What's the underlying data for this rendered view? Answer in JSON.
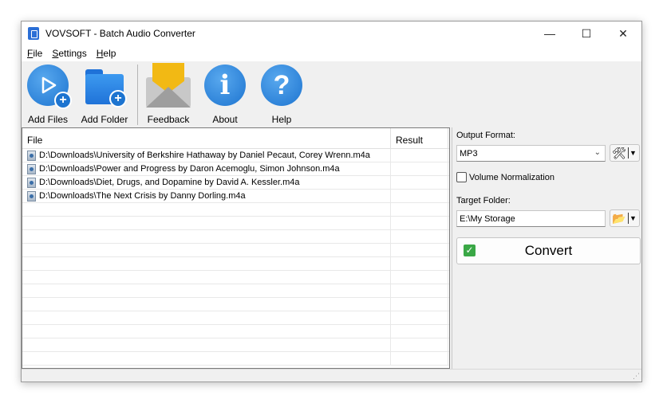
{
  "titlebar": {
    "title": "VOVSOFT - Batch Audio Converter",
    "minimize": "—",
    "maximize": "☐",
    "close": "✕"
  },
  "menu": {
    "file_u": "F",
    "file_rest": "ile",
    "settings_u": "S",
    "settings_rest": "ettings",
    "help_u": "H",
    "help_rest": "elp"
  },
  "toolbar": {
    "add_files": "Add Files",
    "add_folder": "Add Folder",
    "feedback": "Feedback",
    "about": "About",
    "help": "Help",
    "about_glyph": "i",
    "help_glyph": "?",
    "plus_glyph": "+"
  },
  "list": {
    "col_file": "File",
    "col_result": "Result",
    "rows": [
      "D:\\Downloads\\University of Berkshire Hathaway by Daniel Pecaut, Corey Wrenn.m4a",
      "D:\\Downloads\\Power and Progress by Daron Acemoglu, Simon Johnson.m4a",
      "D:\\Downloads\\Diet, Drugs, and Dopamine by David A. Kessler.m4a",
      "D:\\Downloads\\The Next Crisis by Danny Dorling.m4a"
    ]
  },
  "options": {
    "output_format_label": "Output Format:",
    "output_format_value": "MP3",
    "volume_normalization": "Volume Normalization",
    "target_folder_label": "Target Folder:",
    "target_folder_value": "E:\\My Storage",
    "convert": "Convert"
  },
  "icons": {
    "settings": "tools-icon",
    "folder": "folder-open-icon"
  },
  "colors": {
    "accent_blue": "#1d74d0",
    "envelope_yellow": "#f2b914",
    "check_green": "#3aa846"
  }
}
